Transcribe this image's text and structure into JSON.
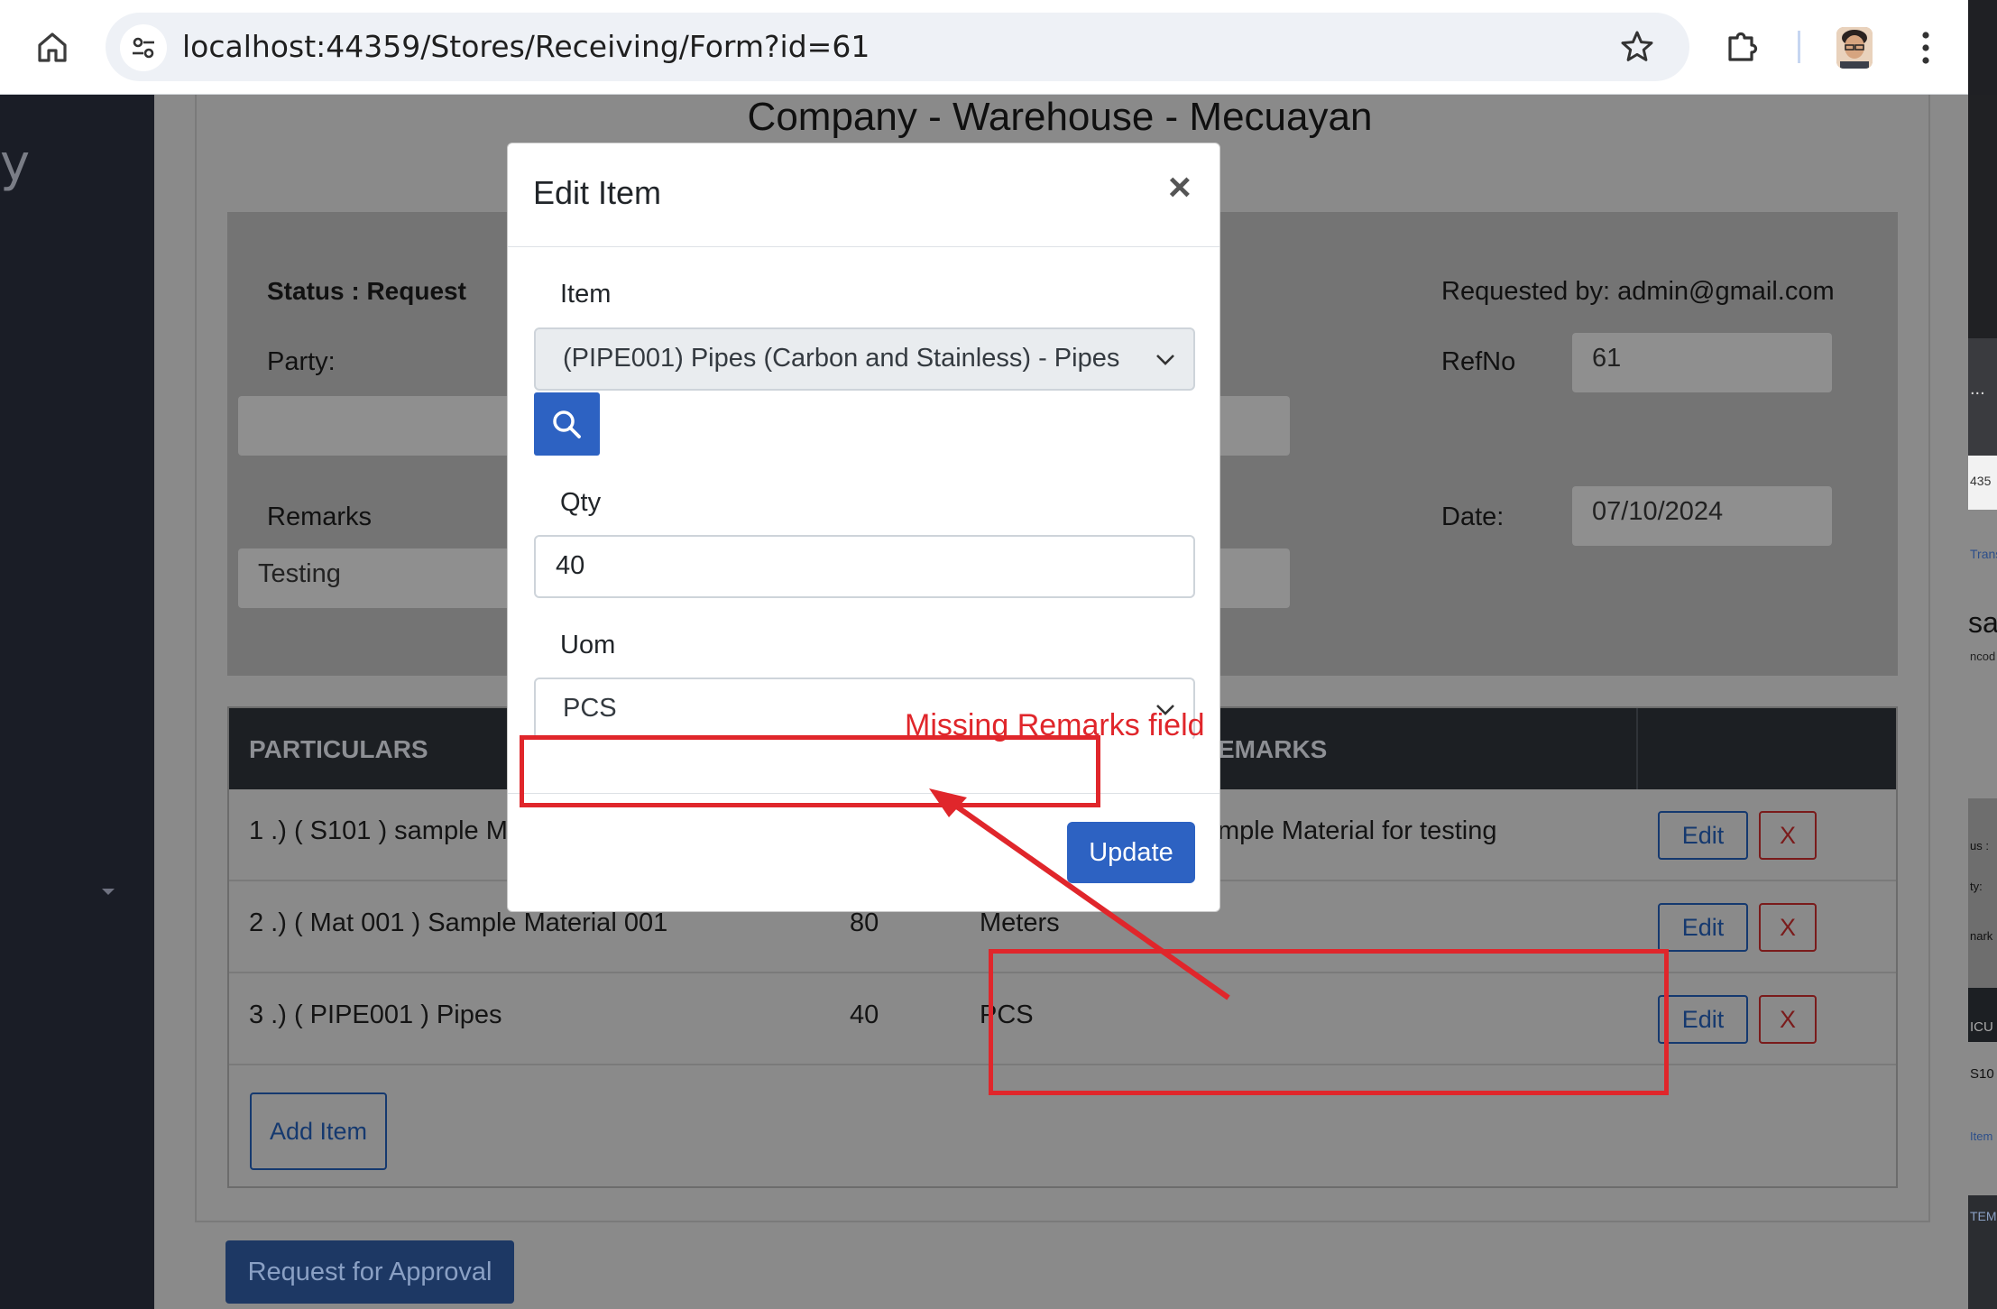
{
  "browser": {
    "url": "localhost:44359/Stores/Receiving/Form?id=61"
  },
  "sidebar": {
    "brand_fragment": "y"
  },
  "page": {
    "title": "Company - Warehouse - Mecuayan",
    "status_label": "Status : Request",
    "party_label": "Party:",
    "party_value": "",
    "remarks_label": "Remarks",
    "remarks_value": "Testing",
    "requested_by": "Requested by: admin@gmail.com",
    "refno_label": "RefNo",
    "refno_value": "61",
    "date_label": "Date:",
    "date_value": "07/10/2024"
  },
  "table": {
    "headers": [
      "PARTICULARS",
      "EMARKS"
    ],
    "rows": [
      {
        "particulars": "1 .) ( S101 ) sample M",
        "qty": "",
        "uom": "",
        "remarks": "mple Material for testing"
      },
      {
        "particulars": "2 .) ( Mat 001 ) Sample Material 001",
        "qty": "80",
        "uom": "Meters",
        "remarks": ""
      },
      {
        "particulars": "3 .) ( PIPE001 ) Pipes",
        "qty": "40",
        "uom": "PCS",
        "remarks": ""
      }
    ],
    "edit_label": "Edit",
    "delete_label": "X",
    "add_item_label": "Add Item"
  },
  "request_approval_label": "Request for Approval",
  "modal": {
    "title": "Edit Item",
    "close_glyph": "×",
    "item_label": "Item",
    "item_value": "(PIPE001) Pipes (Carbon and Stainless) - Pipes",
    "qty_label": "Qty",
    "qty_value": "40",
    "uom_label": "Uom",
    "uom_value": "PCS",
    "update_label": "Update"
  },
  "annotation": {
    "text": "Missing Remarks field",
    "color": "#e0262b"
  },
  "edge_panel": {
    "fragments": [
      "...",
      "435",
      "Trans",
      "sa",
      "ncod",
      "us :",
      "ty:",
      "nark",
      "ICU",
      "S10",
      "Item",
      "TEM"
    ]
  },
  "colors": {
    "primary": "#2d62c2",
    "sidebar": "#1a1d26",
    "table_header": "#1c1f23"
  }
}
